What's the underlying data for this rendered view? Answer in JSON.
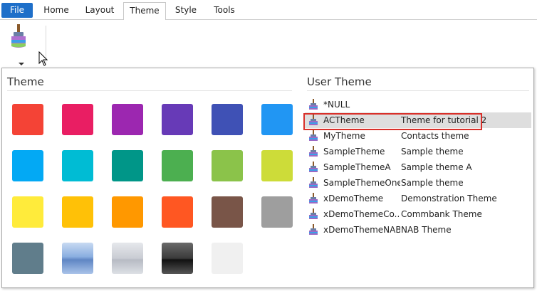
{
  "ribbon": {
    "tabs": [
      "File",
      "Home",
      "Layout",
      "Theme",
      "Style",
      "Tools"
    ],
    "active_tab": "Theme",
    "file_color": "#1e6fc9"
  },
  "dropdown": {
    "theme_title": "Theme",
    "user_theme_title": "User Theme",
    "swatches": [
      "#f44336",
      "#e91e63",
      "#9c27b0",
      "#673ab7",
      "#3f51b5",
      "#2196f3",
      "#03a9f4",
      "#00bcd4",
      "#009688",
      "#4caf50",
      "#8bc34a",
      "#cddc39",
      "#ffeb3b",
      "#ffc107",
      "#ff9800",
      "#ff5722",
      "#795548",
      "#9e9e9e",
      "#607d8b",
      "#8aaee0",
      "#c9ccd3",
      "#3a3a3a",
      "#f0f0f0"
    ],
    "user_themes": [
      {
        "name": "*NULL",
        "desc": ""
      },
      {
        "name": "ACTheme",
        "desc": "Theme for tutorial 2"
      },
      {
        "name": "MyTheme",
        "desc": "Contacts theme"
      },
      {
        "name": "SampleTheme",
        "desc": "Sample theme"
      },
      {
        "name": "SampleThemeA",
        "desc": "Sample theme A"
      },
      {
        "name": "SampleThemeOne",
        "desc": "Sample theme"
      },
      {
        "name": "xDemoTheme",
        "desc": "Demonstration Theme"
      },
      {
        "name": "xDemoThemeCo...",
        "desc": "Commbank Theme"
      },
      {
        "name": "xDemoThemeNAB",
        "desc": "NAB Theme"
      }
    ],
    "selected_index": 1,
    "highlight_color": "#d9302a"
  }
}
